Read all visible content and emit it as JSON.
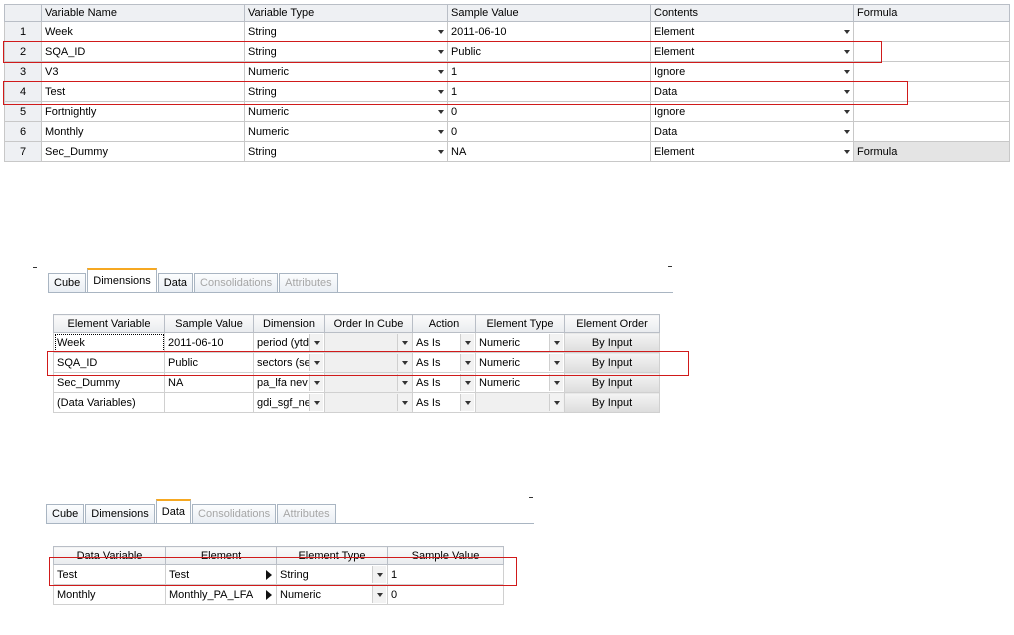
{
  "grid1": {
    "headers": [
      "Variable Name",
      "Variable Type",
      "Sample Value",
      "Contents",
      "Formula"
    ],
    "rows": [
      {
        "num": "1",
        "name": "Week",
        "type": "String",
        "sample": "2011-06-10",
        "contents": "Element",
        "formula": ""
      },
      {
        "num": "2",
        "name": "SQA_ID",
        "type": "String",
        "sample": "Public",
        "contents": "Element",
        "formula": ""
      },
      {
        "num": "3",
        "name": "V3",
        "type": "Numeric",
        "sample": "1",
        "contents": "Ignore",
        "formula": ""
      },
      {
        "num": "4",
        "name": "Test",
        "type": "String",
        "sample": "1",
        "contents": "Data",
        "formula": ""
      },
      {
        "num": "5",
        "name": "Fortnightly",
        "type": "Numeric",
        "sample": "0",
        "contents": "Ignore",
        "formula": ""
      },
      {
        "num": "6",
        "name": "Monthly",
        "type": "Numeric",
        "sample": "0",
        "contents": "Data",
        "formula": ""
      },
      {
        "num": "7",
        "name": "Sec_Dummy",
        "type": "String",
        "sample": "NA",
        "contents": "Element",
        "formula": "Formula"
      }
    ]
  },
  "panel2": {
    "tabs": [
      "Cube",
      "Dimensions",
      "Data",
      "Consolidations",
      "Attributes"
    ],
    "headers": [
      "Element Variable",
      "Sample Value",
      "Dimension",
      "Order In Cube",
      "Action",
      "Element Type",
      "Element Order"
    ],
    "rows": [
      {
        "var": "Week",
        "sample": "2011-06-10",
        "dim": "period (ytd",
        "order": "",
        "action": "As Is",
        "etype": "Numeric",
        "eorder": "By Input"
      },
      {
        "var": "SQA_ID",
        "sample": "Public",
        "dim": "sectors (se",
        "order": "",
        "action": "As Is",
        "etype": "Numeric",
        "eorder": "By Input"
      },
      {
        "var": "Sec_Dummy",
        "sample": "NA",
        "dim": "pa_lfa nev",
        "order": "",
        "action": "As Is",
        "etype": "Numeric",
        "eorder": "By Input"
      },
      {
        "var": "(Data Variables)",
        "sample": "",
        "dim": "gdi_sgf_ne",
        "order": "",
        "action": "As Is",
        "etype": "",
        "eorder": "By Input"
      }
    ]
  },
  "panel3": {
    "tabs": [
      "Cube",
      "Dimensions",
      "Data",
      "Consolidations",
      "Attributes"
    ],
    "headers": [
      "Data Variable",
      "Element",
      "Element Type",
      "Sample Value"
    ],
    "rows": [
      {
        "var": "Test",
        "element": "Test",
        "etype": "String",
        "sample": "1"
      },
      {
        "var": "Monthly",
        "element": "Monthly_PA_LFA",
        "etype": "Numeric",
        "sample": "0"
      }
    ]
  },
  "colors": {
    "highlight": "#d01a1a",
    "tab_accent": "#f6a821"
  }
}
